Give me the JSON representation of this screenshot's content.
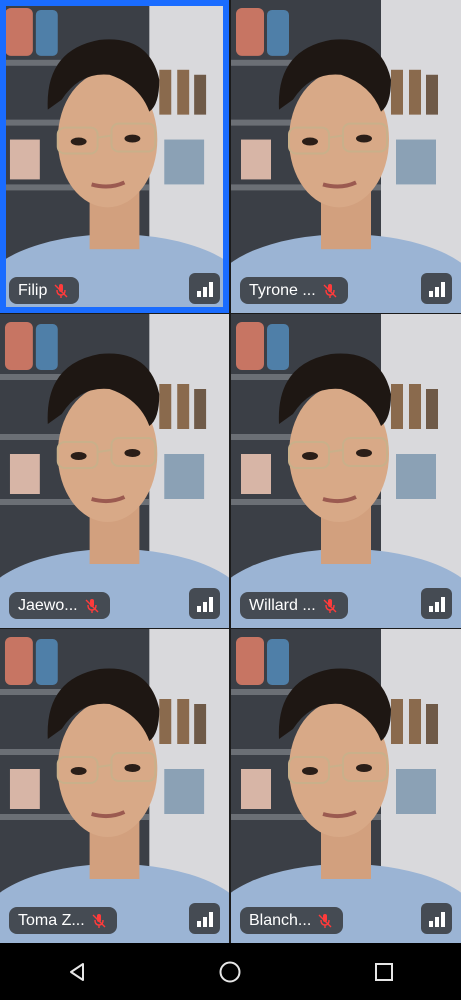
{
  "participants": [
    {
      "name": "Filip",
      "muted": true,
      "active": true
    },
    {
      "name": "Tyrone ...",
      "muted": true,
      "active": false
    },
    {
      "name": "Jaewo...",
      "muted": true,
      "active": false
    },
    {
      "name": "Willard ...",
      "muted": true,
      "active": false
    },
    {
      "name": "Toma Z...",
      "muted": true,
      "active": false
    },
    {
      "name": "Blanch...",
      "muted": true,
      "active": false
    }
  ],
  "icons": {
    "mic_muted": "mic-off-icon",
    "signal": "signal-bars-icon",
    "back": "back-triangle-icon",
    "home": "home-circle-icon",
    "recents": "recents-square-icon"
  },
  "colors": {
    "active_border": "#1a6cff",
    "pill_bg": "#282828",
    "mic_muted": "#ff3b3b"
  }
}
